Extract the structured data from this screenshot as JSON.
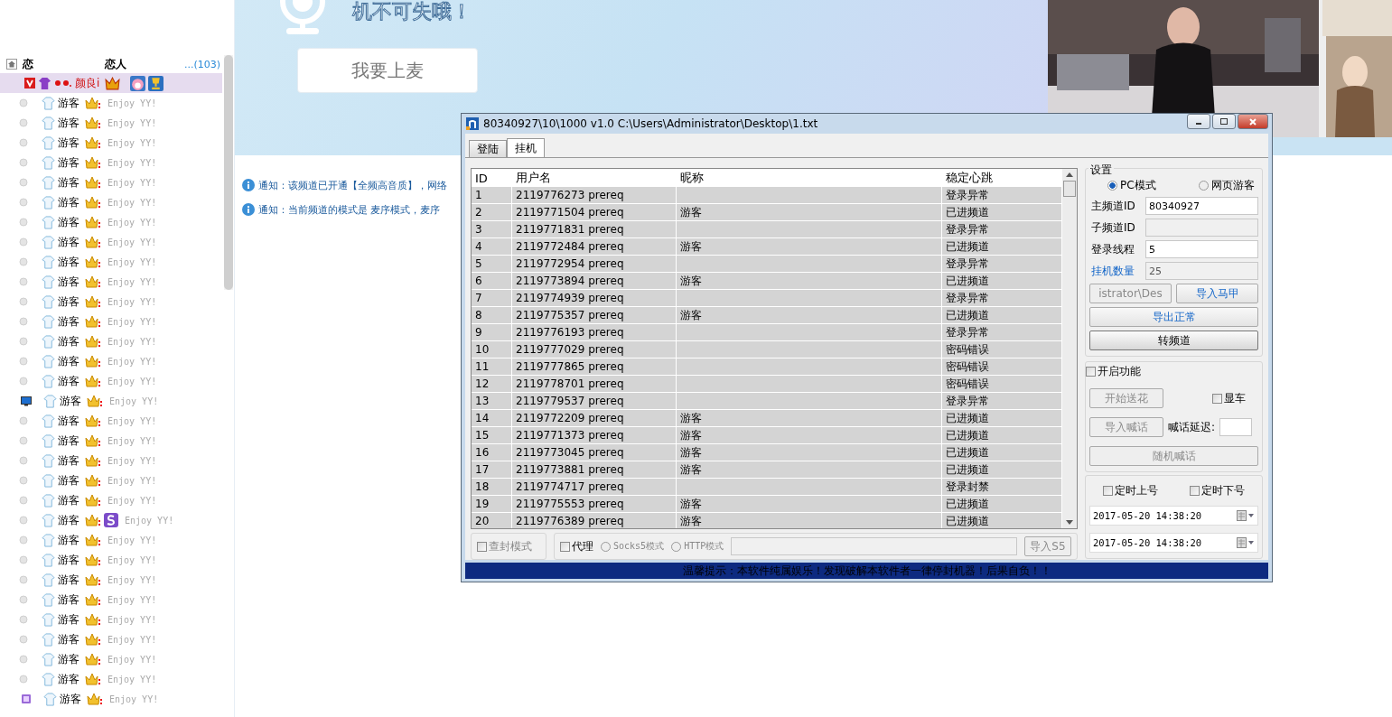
{
  "sidebar": {
    "header": {
      "title": "恋",
      "name": "恋人",
      "count": "...(103)"
    },
    "owner": {
      "name": "颜良i",
      "selected": true
    },
    "members": [
      {
        "name": "游客",
        "status": "Enjoy YY!",
        "kind": "guest"
      },
      {
        "name": "游客",
        "status": "Enjoy YY!",
        "kind": "guest"
      },
      {
        "name": "游客",
        "status": "Enjoy YY!",
        "kind": "guest"
      },
      {
        "name": "游客",
        "status": "Enjoy YY!",
        "kind": "guest"
      },
      {
        "name": "游客",
        "status": "Enjoy YY!",
        "kind": "guest"
      },
      {
        "name": "游客",
        "status": "Enjoy YY!",
        "kind": "guest"
      },
      {
        "name": "游客",
        "status": "Enjoy YY!",
        "kind": "guest"
      },
      {
        "name": "游客",
        "status": "Enjoy YY!",
        "kind": "guest"
      },
      {
        "name": "游客",
        "status": "Enjoy YY!",
        "kind": "guest"
      },
      {
        "name": "游客",
        "status": "Enjoy YY!",
        "kind": "guest"
      },
      {
        "name": "游客",
        "status": "Enjoy YY!",
        "kind": "guest"
      },
      {
        "name": "游客",
        "status": "Enjoy YY!",
        "kind": "guest"
      },
      {
        "name": "游客",
        "status": "Enjoy YY!",
        "kind": "guest"
      },
      {
        "name": "游客",
        "status": "Enjoy YY!",
        "kind": "guest"
      },
      {
        "name": "游客",
        "status": "Enjoy YY!",
        "kind": "guest"
      },
      {
        "name": "游客",
        "status": "Enjoy YY!",
        "kind": "screen"
      },
      {
        "name": "游客",
        "status": "Enjoy YY!",
        "kind": "guest"
      },
      {
        "name": "游客",
        "status": "Enjoy YY!",
        "kind": "guest"
      },
      {
        "name": "游客",
        "status": "Enjoy YY!",
        "kind": "guest"
      },
      {
        "name": "游客",
        "status": "Enjoy YY!",
        "kind": "guest"
      },
      {
        "name": "游客",
        "status": "Enjoy YY!",
        "kind": "guest"
      },
      {
        "name": "游客",
        "status": "Enjoy YY!",
        "kind": "badge"
      },
      {
        "name": "游客",
        "status": "Enjoy YY!",
        "kind": "guest"
      },
      {
        "name": "游客",
        "status": "Enjoy YY!",
        "kind": "guest"
      },
      {
        "name": "游客",
        "status": "Enjoy YY!",
        "kind": "guest"
      },
      {
        "name": "游客",
        "status": "Enjoy YY!",
        "kind": "guest"
      },
      {
        "name": "游客",
        "status": "Enjoy YY!",
        "kind": "guest"
      },
      {
        "name": "游客",
        "status": "Enjoy YY!",
        "kind": "guest"
      },
      {
        "name": "游客",
        "status": "Enjoy YY!",
        "kind": "guest"
      },
      {
        "name": "游客",
        "status": "Enjoy YY!",
        "kind": "guest"
      },
      {
        "name": "游客",
        "status": "Enjoy YY!",
        "kind": "tag"
      }
    ]
  },
  "stage": {
    "headline": "机不可失哦！",
    "mic_button": "我要上麦"
  },
  "notices": [
    "通知：该频道已开通【全频高音质】，网络",
    "通知：当前频道的模式是 麦序模式，麦序"
  ],
  "dialog": {
    "title": "80340927\\10\\1000 v1.0 C:\\Users\\Administrator\\Desktop\\1.txt",
    "tabs": [
      {
        "label": "登陆",
        "selected": false
      },
      {
        "label": "挂机",
        "selected": true
      }
    ],
    "table": {
      "columns": [
        "ID",
        "用户名",
        "昵称",
        "稳定心跳"
      ],
      "rows": [
        {
          "id": "1",
          "username": "2119776273 prereq",
          "status": "登录异常"
        },
        {
          "id": "2",
          "username": "2119771504 prereq",
          "nickname": "游客",
          "status": "已进频道"
        },
        {
          "id": "3",
          "username": "2119771831 prereq",
          "status": "登录异常"
        },
        {
          "id": "4",
          "username": "2119772484 prereq",
          "nickname": "游客",
          "status": "已进频道"
        },
        {
          "id": "5",
          "username": "2119772954 prereq",
          "status": "登录异常"
        },
        {
          "id": "6",
          "username": "2119773894 prereq",
          "nickname": "游客",
          "status": "已进频道"
        },
        {
          "id": "7",
          "username": "2119774939 prereq",
          "status": "登录异常"
        },
        {
          "id": "8",
          "username": "2119775357 prereq",
          "nickname": "游客",
          "status": "已进频道"
        },
        {
          "id": "9",
          "username": "2119776193 prereq",
          "status": "登录异常"
        },
        {
          "id": "10",
          "username": "2119777029 prereq",
          "status": "密码错误"
        },
        {
          "id": "11",
          "username": "2119777865 prereq",
          "status": "密码错误"
        },
        {
          "id": "12",
          "username": "2119778701 prereq",
          "status": "密码错误"
        },
        {
          "id": "13",
          "username": "2119779537 prereq",
          "status": "登录异常"
        },
        {
          "id": "14",
          "username": "2119772209 prereq",
          "nickname": "游客",
          "status": "已进频道"
        },
        {
          "id": "15",
          "username": "2119771373 prereq",
          "nickname": "游客",
          "status": "已进频道"
        },
        {
          "id": "16",
          "username": "2119773045 prereq",
          "nickname": "游客",
          "status": "已进频道"
        },
        {
          "id": "17",
          "username": "2119773881 prereq",
          "nickname": "游客",
          "status": "已进频道"
        },
        {
          "id": "18",
          "username": "2119774717 prereq",
          "status": "登录封禁"
        },
        {
          "id": "19",
          "username": "2119775553 prereq",
          "nickname": "游客",
          "status": "已进频道"
        },
        {
          "id": "20",
          "username": "2119776389 prereq",
          "nickname": "游客",
          "status": "已进频道"
        }
      ]
    },
    "settings": {
      "title": "设置",
      "modes": [
        {
          "label": "PC模式",
          "selected": true
        },
        {
          "label": "网页游客",
          "selected": false
        }
      ],
      "fields": [
        {
          "label": "主频道ID",
          "value": "80340927",
          "disabled": false,
          "accent": false
        },
        {
          "label": "子频道ID",
          "disabled": true,
          "accent": false
        },
        {
          "label": "登录线程",
          "value": "5",
          "disabled": false,
          "accent": false
        },
        {
          "label": "挂机数量",
          "value": "25",
          "disabled": true,
          "accent": true
        }
      ],
      "file_button": {
        "label": "istrator\\Des",
        "disabled": true,
        "accent": false
      },
      "import_button": {
        "label": "导入马甲",
        "disabled": false,
        "accent": true
      },
      "export_button": {
        "label": "导出正常",
        "disabled": false,
        "accent": true
      },
      "switch_button": {
        "label": "转频道",
        "disabled": false,
        "accent": false
      }
    },
    "features": {
      "enable": {
        "label": "开启功能",
        "checked": false
      },
      "flower_button": {
        "label": "开始送花",
        "disabled": true,
        "accent": false
      },
      "show_car": {
        "label": "显车",
        "checked": false
      },
      "import_shout_button": {
        "label": "导入喊话",
        "disabled": true,
        "accent": false
      },
      "shout_delay_label": "喊话延迟:",
      "random_shout_button": {
        "label": "随机喊话",
        "disabled": true,
        "accent": false
      }
    },
    "schedule": {
      "checks": [
        {
          "label": "定时上号",
          "checked": false
        },
        {
          "label": "定时下号",
          "checked": false
        }
      ],
      "times": [
        "2017-05-20 14:38:20",
        "2017-05-20 14:38:20"
      ]
    },
    "proxy": {
      "ban_mode": {
        "label": "查封模式",
        "checked": false,
        "disabled": true
      },
      "proxy": {
        "label": "代理",
        "checked": false,
        "disabled": false
      },
      "types": [
        {
          "label": "Socks5模式",
          "selected": false
        },
        {
          "label": "HTTP模式",
          "selected": false
        }
      ],
      "import_button": {
        "label": "导入S5",
        "disabled": true,
        "accent": false
      }
    },
    "footer": "温馨提示：本软件纯属娱乐！发现破解本软件者一律停封机器！后果自负！！"
  }
}
